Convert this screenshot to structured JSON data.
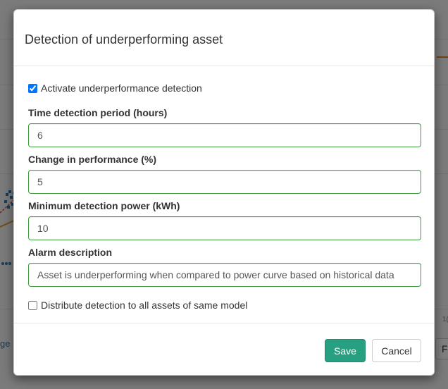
{
  "background": {
    "link_text": "ge",
    "button_text": "F",
    "tick_text": "1("
  },
  "modal": {
    "title": "Detection of underperforming asset",
    "activate_label": "Activate underperformance detection",
    "activate_checked": true,
    "fields": [
      {
        "label": "Time detection period (hours)",
        "value": "6"
      },
      {
        "label": "Change in performance (%)",
        "value": "5"
      },
      {
        "label": "Minimum detection power (kWh)",
        "value": "10"
      },
      {
        "label": "Alarm description",
        "value": "Asset is underperforming when compared to power curve based on historical data"
      }
    ],
    "distribute_label": "Distribute detection to all assets of same model",
    "distribute_checked": false,
    "save_label": "Save",
    "cancel_label": "Cancel"
  },
  "colors": {
    "accent": "#26a080",
    "input_border": "#3c9c3c"
  }
}
